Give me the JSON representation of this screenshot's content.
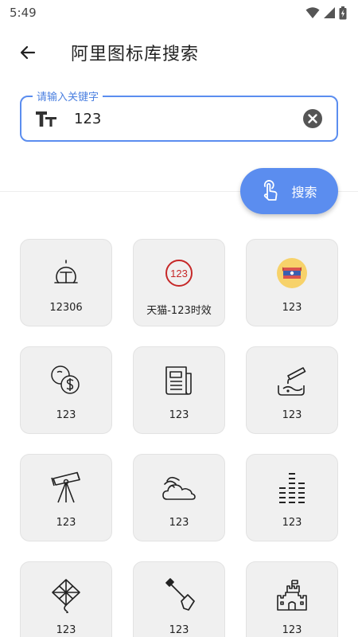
{
  "status": {
    "time": "5:49"
  },
  "header": {
    "title": "阿里图标库搜索"
  },
  "search": {
    "label": "请输入关键字",
    "value": "123"
  },
  "fab": {
    "label": "搜索"
  },
  "colors": {
    "accent": "#5b8def",
    "card_bg": "#f0f0f0",
    "badge_red": "#c62828",
    "flag_yellow": "#f7d26a"
  },
  "results": [
    {
      "label": "12306",
      "icon": "rail-station-icon"
    },
    {
      "label": "天猫-123时效",
      "icon": "number-badge-icon",
      "badge": "123"
    },
    {
      "label": "123",
      "icon": "flag-badge-icon"
    },
    {
      "label": "123",
      "icon": "coins-dollar-icon"
    },
    {
      "label": "123",
      "icon": "newspaper-icon"
    },
    {
      "label": "123",
      "icon": "pouring-liquid-icon"
    },
    {
      "label": "123",
      "icon": "telescope-icon"
    },
    {
      "label": "123",
      "icon": "cloud-wifi-icon"
    },
    {
      "label": "123",
      "icon": "equalizer-icon"
    },
    {
      "label": "123",
      "icon": "kite-icon"
    },
    {
      "label": "123",
      "icon": "shovel-icon"
    },
    {
      "label": "123",
      "icon": "sandcastle-icon"
    }
  ]
}
